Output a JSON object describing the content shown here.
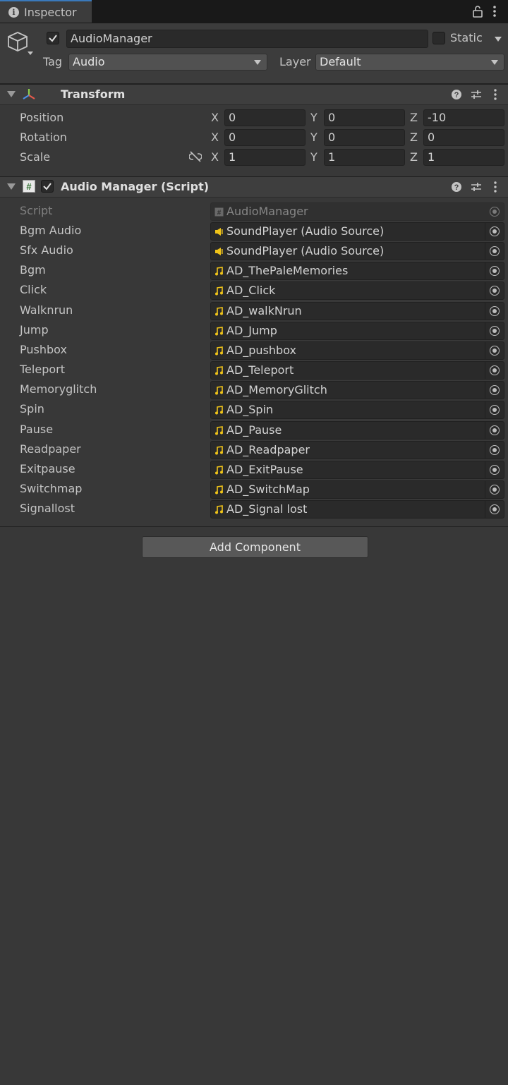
{
  "tab": {
    "title": "Inspector"
  },
  "gameobject": {
    "active": true,
    "name": "AudioManager",
    "static_label": "Static",
    "static_checked": false,
    "tag_label": "Tag",
    "tag_value": "Audio",
    "layer_label": "Layer",
    "layer_value": "Default"
  },
  "transform": {
    "title": "Transform",
    "rows": [
      {
        "label": "Position",
        "x": "0",
        "y": "0",
        "z": "-10"
      },
      {
        "label": "Rotation",
        "x": "0",
        "y": "0",
        "z": "0"
      },
      {
        "label": "Scale",
        "x": "1",
        "y": "1",
        "z": "1"
      }
    ],
    "axes": {
      "x": "X",
      "y": "Y",
      "z": "Z"
    }
  },
  "audio_manager": {
    "title": "Audio Manager (Script)",
    "enabled": true,
    "script": {
      "label": "Script",
      "value": "AudioManager"
    },
    "fields": [
      {
        "label": "Bgm Audio",
        "value": "SoundPlayer (Audio Source)",
        "icon": "speaker-icon"
      },
      {
        "label": "Sfx Audio",
        "value": "SoundPlayer (Audio Source)",
        "icon": "speaker-icon"
      },
      {
        "label": "Bgm",
        "value": "AD_ThePaleMemories",
        "icon": "music-note-icon"
      },
      {
        "label": "Click",
        "value": "AD_Click",
        "icon": "music-note-icon"
      },
      {
        "label": "Walknrun",
        "value": "AD_walkNrun",
        "icon": "music-note-icon"
      },
      {
        "label": "Jump",
        "value": "AD_Jump",
        "icon": "music-note-icon"
      },
      {
        "label": "Pushbox",
        "value": "AD_pushbox",
        "icon": "music-note-icon"
      },
      {
        "label": "Teleport",
        "value": "AD_Teleport",
        "icon": "music-note-icon"
      },
      {
        "label": "Memoryglitch",
        "value": "AD_MemoryGlitch",
        "icon": "music-note-icon"
      },
      {
        "label": "Spin",
        "value": "AD_Spin",
        "icon": "music-note-icon"
      },
      {
        "label": "Pause",
        "value": "AD_Pause",
        "icon": "music-note-icon"
      },
      {
        "label": "Readpaper",
        "value": "AD_Readpaper",
        "icon": "music-note-icon"
      },
      {
        "label": "Exitpause",
        "value": "AD_ExitPause",
        "icon": "music-note-icon"
      },
      {
        "label": "Switchmap",
        "value": "AD_SwitchMap",
        "icon": "music-note-icon"
      },
      {
        "label": "Signallost",
        "value": "AD_Signal lost",
        "icon": "music-note-icon"
      }
    ]
  },
  "add_component_label": "Add Component",
  "colors": {
    "background": "#383838",
    "field": "#2a2a2a",
    "accent_tab": "#3a79bb",
    "audio_icon": "#f0c419"
  }
}
